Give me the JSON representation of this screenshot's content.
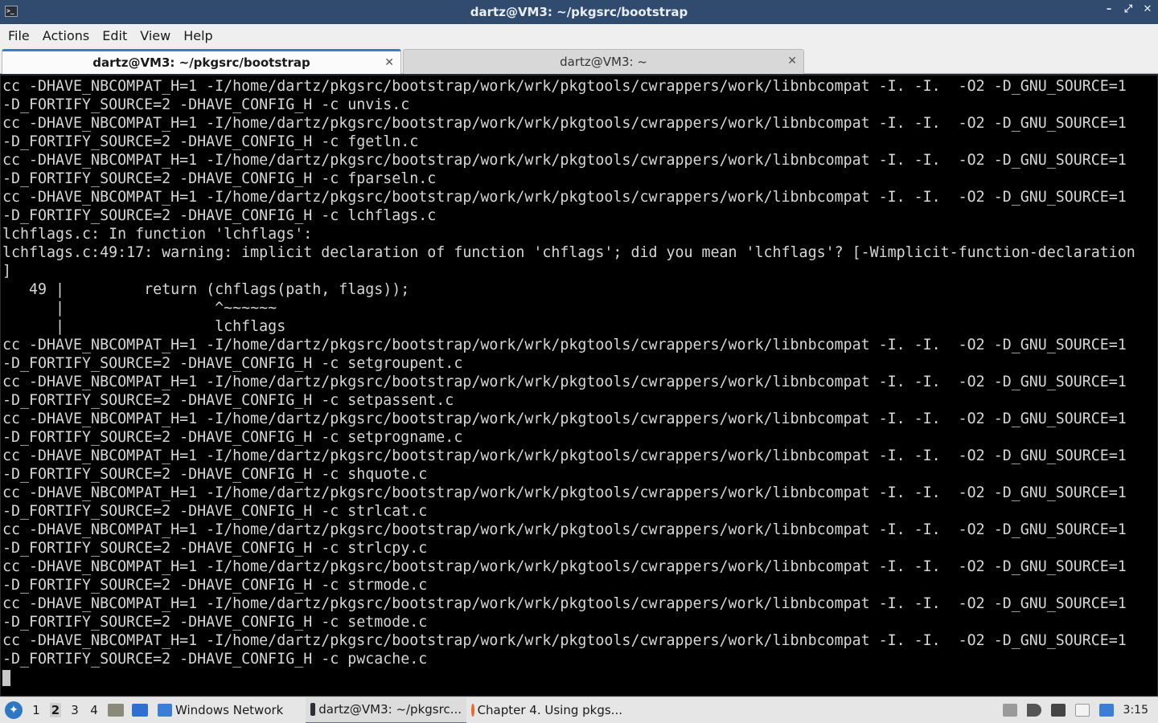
{
  "window": {
    "title": "dartz@VM3: ~/pkgsrc/bootstrap",
    "controls": [
      "–",
      "⤢",
      "✕"
    ]
  },
  "menu": [
    "File",
    "Actions",
    "Edit",
    "View",
    "Help"
  ],
  "tabs": [
    {
      "label": "dartz@VM3: ~/pkgsrc/bootstrap",
      "close": "✕"
    },
    {
      "label": "dartz@VM3: ~",
      "close": "✕"
    }
  ],
  "terminal": {
    "lines": [
      "cc -DHAVE_NBCOMPAT_H=1 -I/home/dartz/pkgsrc/bootstrap/work/wrk/pkgtools/cwrappers/work/libnbcompat -I. -I.  -O2 -D_GNU_SOURCE=1",
      "-D_FORTIFY_SOURCE=2 -DHAVE_CONFIG_H -c unvis.c",
      "cc -DHAVE_NBCOMPAT_H=1 -I/home/dartz/pkgsrc/bootstrap/work/wrk/pkgtools/cwrappers/work/libnbcompat -I. -I.  -O2 -D_GNU_SOURCE=1",
      "-D_FORTIFY_SOURCE=2 -DHAVE_CONFIG_H -c fgetln.c",
      "cc -DHAVE_NBCOMPAT_H=1 -I/home/dartz/pkgsrc/bootstrap/work/wrk/pkgtools/cwrappers/work/libnbcompat -I. -I.  -O2 -D_GNU_SOURCE=1",
      "-D_FORTIFY_SOURCE=2 -DHAVE_CONFIG_H -c fparseln.c",
      "cc -DHAVE_NBCOMPAT_H=1 -I/home/dartz/pkgsrc/bootstrap/work/wrk/pkgtools/cwrappers/work/libnbcompat -I. -I.  -O2 -D_GNU_SOURCE=1",
      "-D_FORTIFY_SOURCE=2 -DHAVE_CONFIG_H -c lchflags.c",
      "lchflags.c: In function 'lchflags':",
      "lchflags.c:49:17: warning: implicit declaration of function 'chflags'; did you mean 'lchflags'? [-Wimplicit-function-declaration",
      "]",
      "   49 |         return (chflags(path, flags));",
      "      |                 ^~~~~~~",
      "      |                 lchflags",
      "cc -DHAVE_NBCOMPAT_H=1 -I/home/dartz/pkgsrc/bootstrap/work/wrk/pkgtools/cwrappers/work/libnbcompat -I. -I.  -O2 -D_GNU_SOURCE=1",
      "-D_FORTIFY_SOURCE=2 -DHAVE_CONFIG_H -c setgroupent.c",
      "cc -DHAVE_NBCOMPAT_H=1 -I/home/dartz/pkgsrc/bootstrap/work/wrk/pkgtools/cwrappers/work/libnbcompat -I. -I.  -O2 -D_GNU_SOURCE=1",
      "-D_FORTIFY_SOURCE=2 -DHAVE_CONFIG_H -c setpassent.c",
      "cc -DHAVE_NBCOMPAT_H=1 -I/home/dartz/pkgsrc/bootstrap/work/wrk/pkgtools/cwrappers/work/libnbcompat -I. -I.  -O2 -D_GNU_SOURCE=1",
      "-D_FORTIFY_SOURCE=2 -DHAVE_CONFIG_H -c setprogname.c",
      "cc -DHAVE_NBCOMPAT_H=1 -I/home/dartz/pkgsrc/bootstrap/work/wrk/pkgtools/cwrappers/work/libnbcompat -I. -I.  -O2 -D_GNU_SOURCE=1",
      "-D_FORTIFY_SOURCE=2 -DHAVE_CONFIG_H -c shquote.c",
      "cc -DHAVE_NBCOMPAT_H=1 -I/home/dartz/pkgsrc/bootstrap/work/wrk/pkgtools/cwrappers/work/libnbcompat -I. -I.  -O2 -D_GNU_SOURCE=1",
      "-D_FORTIFY_SOURCE=2 -DHAVE_CONFIG_H -c strlcat.c",
      "cc -DHAVE_NBCOMPAT_H=1 -I/home/dartz/pkgsrc/bootstrap/work/wrk/pkgtools/cwrappers/work/libnbcompat -I. -I.  -O2 -D_GNU_SOURCE=1",
      "-D_FORTIFY_SOURCE=2 -DHAVE_CONFIG_H -c strlcpy.c",
      "cc -DHAVE_NBCOMPAT_H=1 -I/home/dartz/pkgsrc/bootstrap/work/wrk/pkgtools/cwrappers/work/libnbcompat -I. -I.  -O2 -D_GNU_SOURCE=1",
      "-D_FORTIFY_SOURCE=2 -DHAVE_CONFIG_H -c strmode.c",
      "cc -DHAVE_NBCOMPAT_H=1 -I/home/dartz/pkgsrc/bootstrap/work/wrk/pkgtools/cwrappers/work/libnbcompat -I. -I.  -O2 -D_GNU_SOURCE=1",
      "-D_FORTIFY_SOURCE=2 -DHAVE_CONFIG_H -c setmode.c",
      "cc -DHAVE_NBCOMPAT_H=1 -I/home/dartz/pkgsrc/bootstrap/work/wrk/pkgtools/cwrappers/work/libnbcompat -I. -I.  -O2 -D_GNU_SOURCE=1",
      "-D_FORTIFY_SOURCE=2 -DHAVE_CONFIG_H -c pwcache.c"
    ]
  },
  "panel": {
    "workspaces": [
      "1",
      "2",
      "3",
      "4"
    ],
    "active_workspace_index": 1,
    "tasks": [
      {
        "label": "Windows Network",
        "icon": "folder-icon"
      },
      {
        "label": "dartz@VM3: ~/pkgsrc...",
        "icon": "terminal-icon"
      },
      {
        "label": "Chapter 4. Using pkgs...",
        "icon": "firefox-icon"
      }
    ],
    "clock": "3:15"
  },
  "colors": {
    "titlebar": "#314b6e",
    "terminal_bg": "#000000",
    "terminal_fg": "#d6d6d6",
    "accent": "#3a7bd5"
  }
}
